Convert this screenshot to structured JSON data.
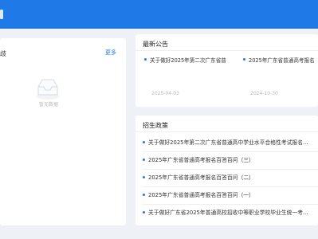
{
  "left_panel": {
    "title_fragment": "歧",
    "more_label": "更多",
    "empty_text": "暂无数据",
    "icon": "inbox-empty-icon"
  },
  "notices": {
    "title": "最新公告",
    "items": [
      {
        "title": "关于做好2025年第二次广东省普",
        "date": "2025-04-03"
      },
      {
        "title": "2025年广东省普通高考报名",
        "date": "2024-10-30"
      }
    ]
  },
  "policies": {
    "title": "招生政策",
    "items": [
      {
        "title": "关于做好2025年第二次广东省普通高中学业水平合格性考试报名..."
      },
      {
        "title": "2025年广东省普通高考报名百答百问（三）"
      },
      {
        "title": "2025年广东省普通高考报名百答百问（二）"
      },
      {
        "title": "2025年广东省普通高考报名百答百问（一）"
      },
      {
        "title": "关于做好广东省2025年普通高校招收中等职业学校毕业生统一考..."
      }
    ]
  },
  "colors": {
    "accent": "#1f7ae8",
    "background": "#eef1f6"
  }
}
